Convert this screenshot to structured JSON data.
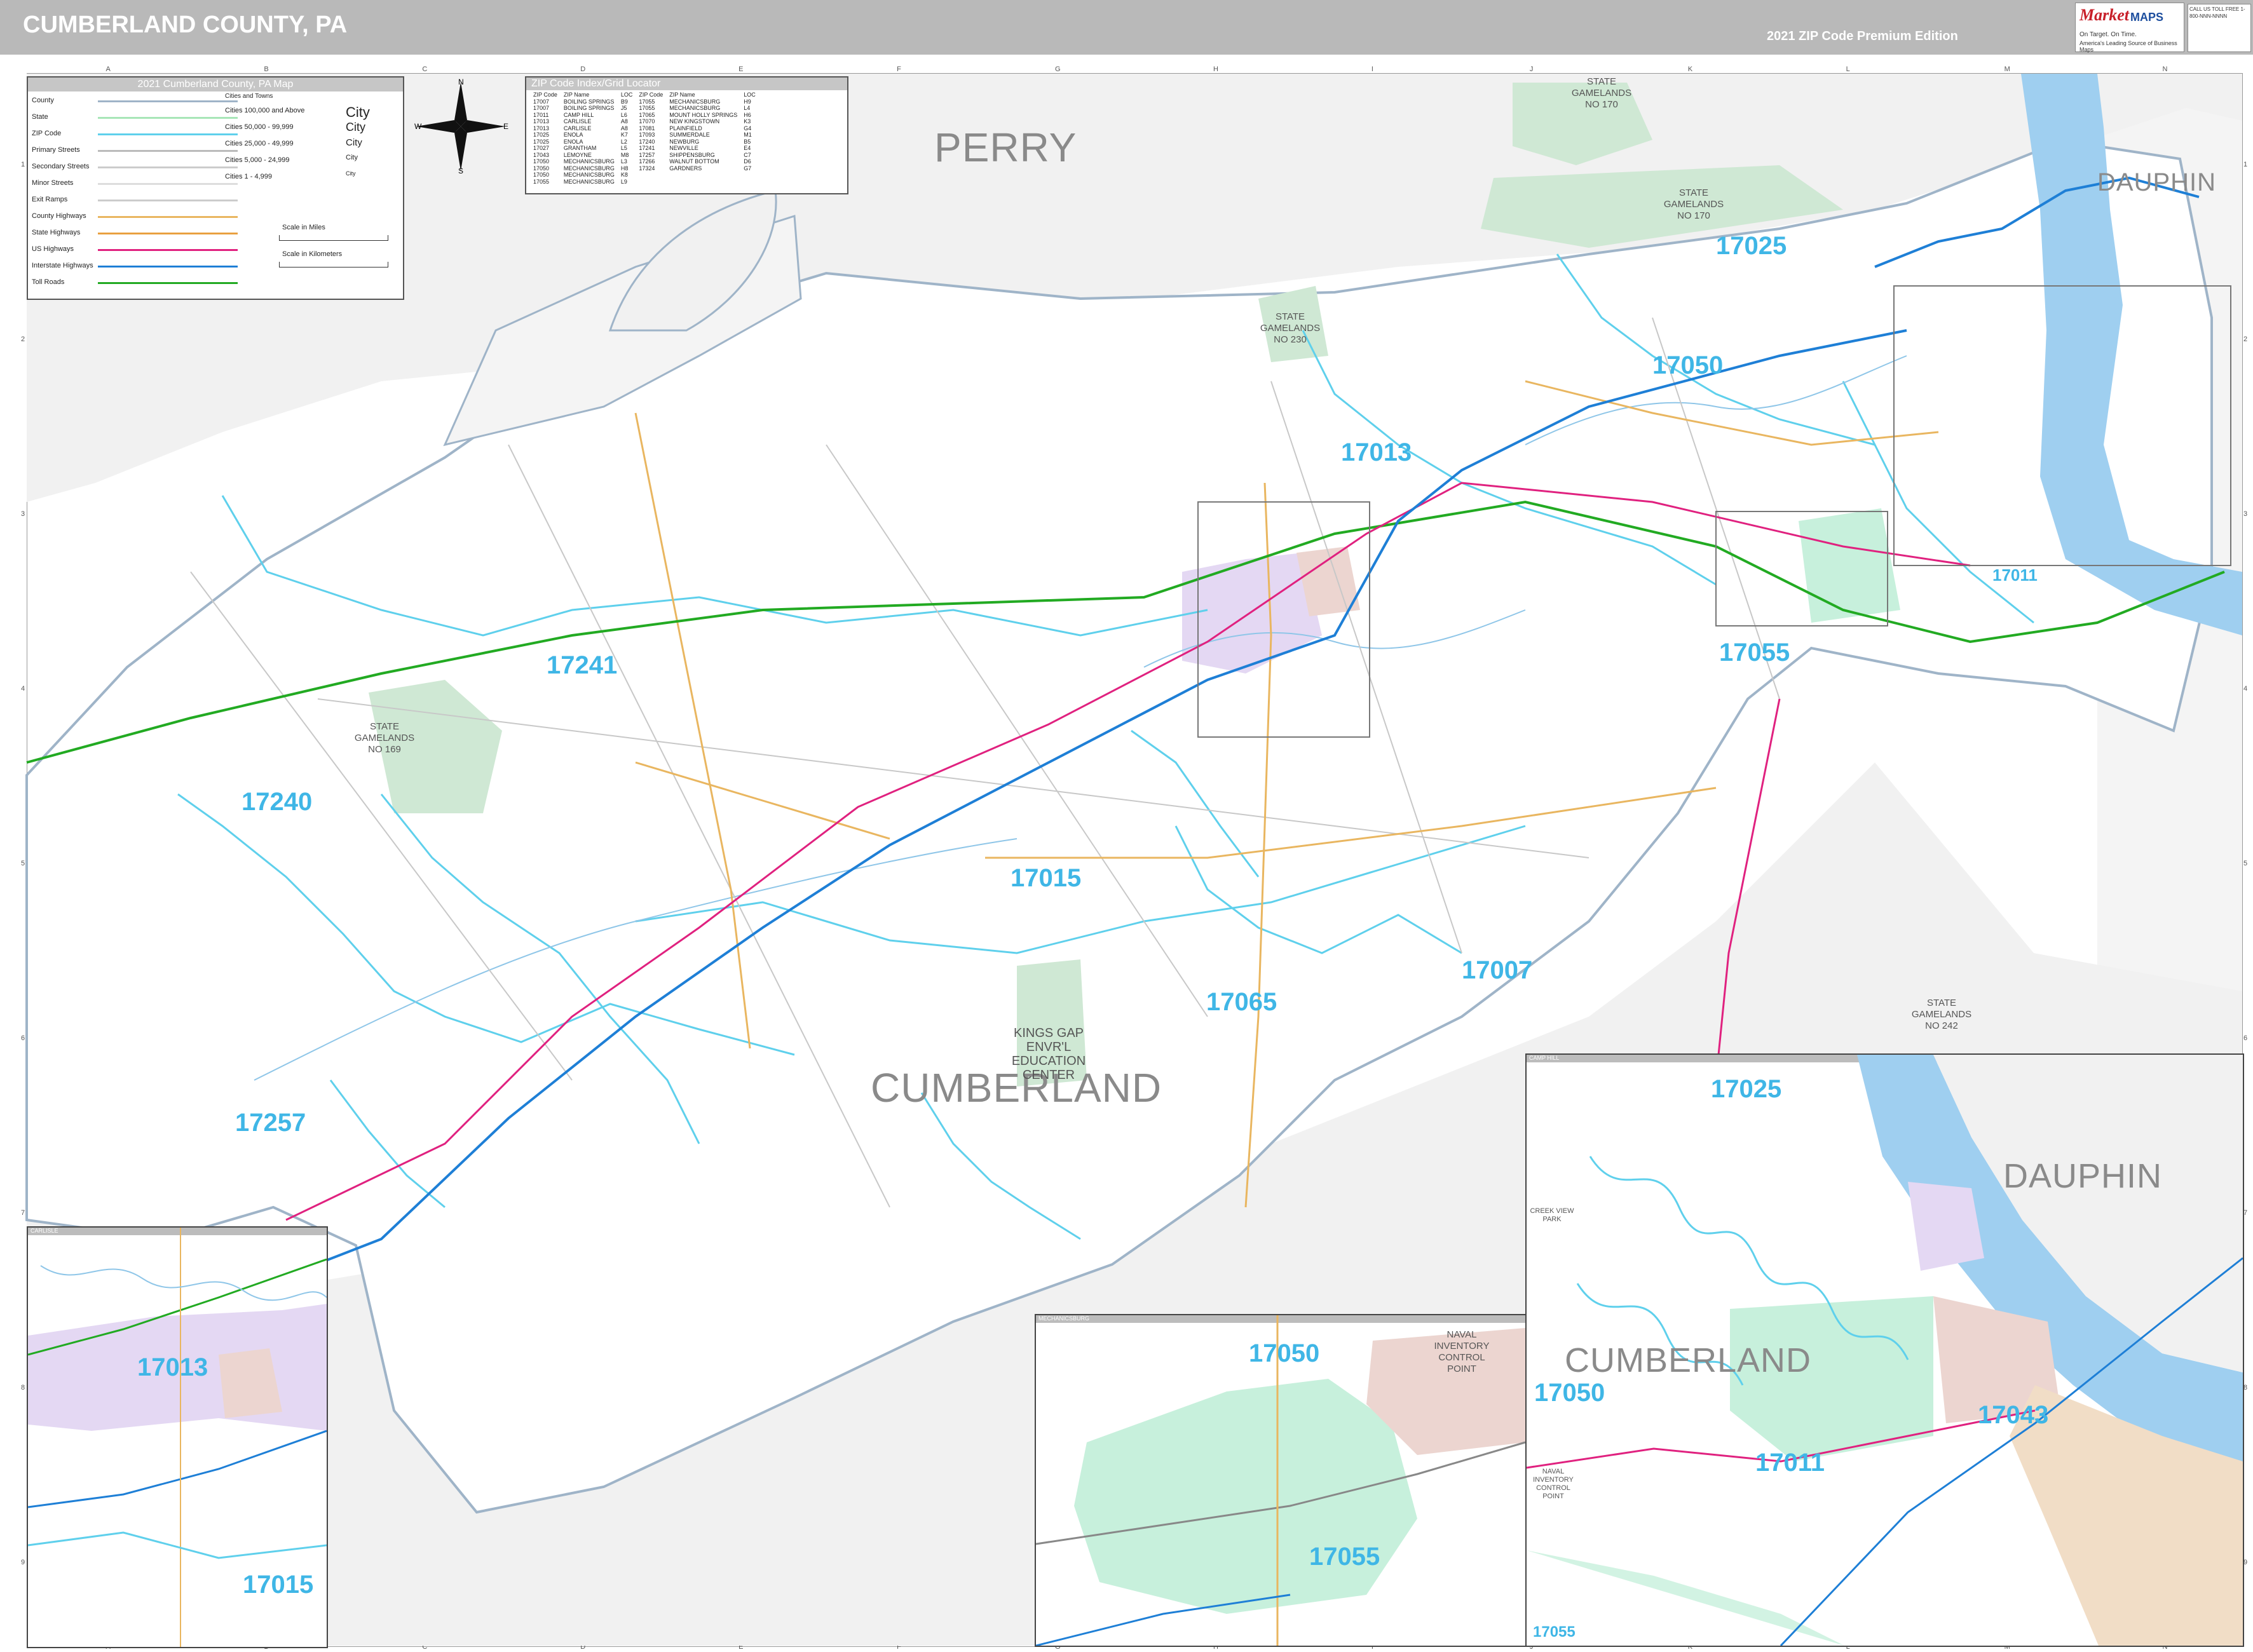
{
  "header": {
    "title": "CUMBERLAND COUNTY, PA",
    "edition": "2021 ZIP Code Premium Edition",
    "logo_line1": "Market",
    "logo_line2": "MAPS",
    "logo_tagline1": "On Target. On Time.",
    "logo_tagline2": "America's Leading Source of Business Maps",
    "phone_text": "CALL US TOLL FREE 1-800-NNN-NNNN"
  },
  "legend": {
    "title": "2021 Cumberland County, PA Map",
    "items": [
      "County",
      "State",
      "ZIP Code",
      "Primary Streets",
      "Secondary Streets",
      "Minor Streets",
      "Exit Ramps",
      "County Highways",
      "State Highways",
      "US Highways",
      "Interstate Highways",
      "Toll Roads"
    ],
    "cities_header": "Cities and Towns",
    "cities": [
      {
        "label": "Cities 100,000 and Above",
        "sample": "City"
      },
      {
        "label": "Cities 50,000 - 99,999",
        "sample": "City"
      },
      {
        "label": "Cities 25,000 - 49,999",
        "sample": "City"
      },
      {
        "label": "Cities 5,000 - 24,999",
        "sample": "City"
      },
      {
        "label": "Cities 1 - 4,999",
        "sample": "City"
      }
    ],
    "scale_miles": "Scale in Miles",
    "scale_km": "Scale in Kilometers"
  },
  "zip_index": {
    "title": "ZIP Code Index/Grid Locator",
    "columns": [
      "ZIP Code",
      "ZIP Name",
      "LOC",
      "ZIP Code",
      "ZIP Name",
      "LOC"
    ],
    "rows": [
      [
        "17007",
        "BOILING SPRINGS",
        "B9",
        "17055",
        "MECHANICSBURG",
        "H9"
      ],
      [
        "17007",
        "BOILING SPRINGS",
        "J5",
        "17055",
        "MECHANICSBURG",
        "L4"
      ],
      [
        "17011",
        "CAMP HILL",
        "L6",
        "17065",
        "MOUNT HOLLY SPRINGS",
        "H6"
      ],
      [
        "17013",
        "CARLISLE",
        "A8",
        "17070",
        "NEW KINGSTOWN",
        "K3"
      ],
      [
        "17013",
        "CARLISLE",
        "A8",
        "17081",
        "PLAINFIELD",
        "G4"
      ],
      [
        "17025",
        "ENOLA",
        "K7",
        "17093",
        "SUMMERDALE",
        "M1"
      ],
      [
        "17025",
        "ENOLA",
        "L2",
        "17240",
        "NEWBURG",
        "B5"
      ],
      [
        "17027",
        "GRANTHAM",
        "L5",
        "17241",
        "NEWVILLE",
        "E4"
      ],
      [
        "17043",
        "LEMOYNE",
        "M8",
        "17257",
        "SHIPPENSBURG",
        "C7"
      ],
      [
        "17050",
        "MECHANICSBURG",
        "L3",
        "17266",
        "WALNUT BOTTOM",
        "D6"
      ],
      [
        "17050",
        "MECHANICSBURG",
        "H8",
        "17324",
        "GARDNERS",
        "G7"
      ],
      [
        "17050",
        "MECHANICSBURG",
        "K8",
        "",
        "",
        ""
      ],
      [
        "17055",
        "MECHANICSBURG",
        "L9",
        "",
        "",
        ""
      ]
    ]
  },
  "compass": {
    "n": "N",
    "s": "S",
    "e": "E",
    "w": "W"
  },
  "grid": {
    "columns": [
      "A",
      "B",
      "C",
      "D",
      "E",
      "F",
      "G",
      "H",
      "I",
      "J",
      "K",
      "L",
      "M",
      "N"
    ],
    "rows": [
      "1",
      "2",
      "3",
      "4",
      "5",
      "6",
      "7",
      "8",
      "9"
    ]
  },
  "counties": {
    "perry": "PERRY",
    "dauphin": "DAUPHIN",
    "cumberland": "CUMBERLAND"
  },
  "zips": {
    "z17025": "17025",
    "z17050": "17050",
    "z17013": "17013",
    "z17241": "17241",
    "z17055": "17055",
    "z17240": "17240",
    "z17015": "17015",
    "z17007": "17007",
    "z17065": "17065",
    "z17257": "17257",
    "z17011": "17011"
  },
  "gamelands": {
    "g170a": "STATE GAMELANDS NO 170",
    "g170b": "STATE GAMELANDS NO 170",
    "g230": "STATE GAMELANDS NO 230",
    "g169": "STATE GAMELANDS NO 169",
    "g242": "STATE GAMELANDS NO 242",
    "kingsgap": "KINGS GAP ENVR'L EDUCATION CENTER"
  },
  "inset_carlisle": {
    "header": "CARLISLE",
    "zip1": "17013",
    "zip2": "17015"
  },
  "inset_mech": {
    "header": "MECHANICSBURG",
    "zip1": "17050",
    "zip2": "17055",
    "naval": "NAVAL INVENTORY CONTROL POINT"
  },
  "inset_camphill": {
    "header": "CAMP HILL",
    "zip1": "17025",
    "zip2": "17050",
    "zip3": "17011",
    "zip4": "17043",
    "zip5": "17055",
    "county1": "DAUPHIN",
    "county2": "CUMBERLAND",
    "park": "CREEK VIEW PARK",
    "naval": "NAVAL INVENTORY CONTROL POINT"
  }
}
